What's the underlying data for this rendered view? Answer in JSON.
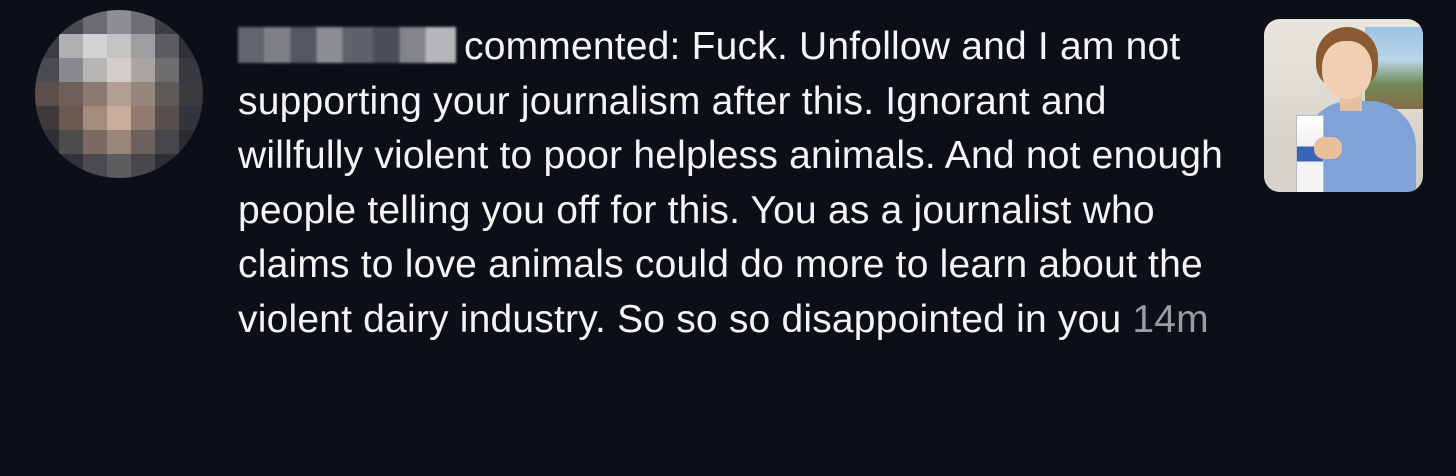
{
  "notification": {
    "action_text": "commented: Fuck. Unfollow and I am not supporting your journalism after this. Ignorant and willfully violent to poor helpless animals. And not enough people telling you off for this. You as a journalist who claims to love animals could do more to learn about the violent dairy industry. So so so disappointed in you",
    "timestamp": "14m",
    "avatar_icon": "pixelated-avatar",
    "thumbnail_icon": "post-thumbnail-photo"
  },
  "colors": {
    "background": "#0d0f18",
    "text": "#f4f4f6",
    "timestamp": "#9a9ca5"
  }
}
